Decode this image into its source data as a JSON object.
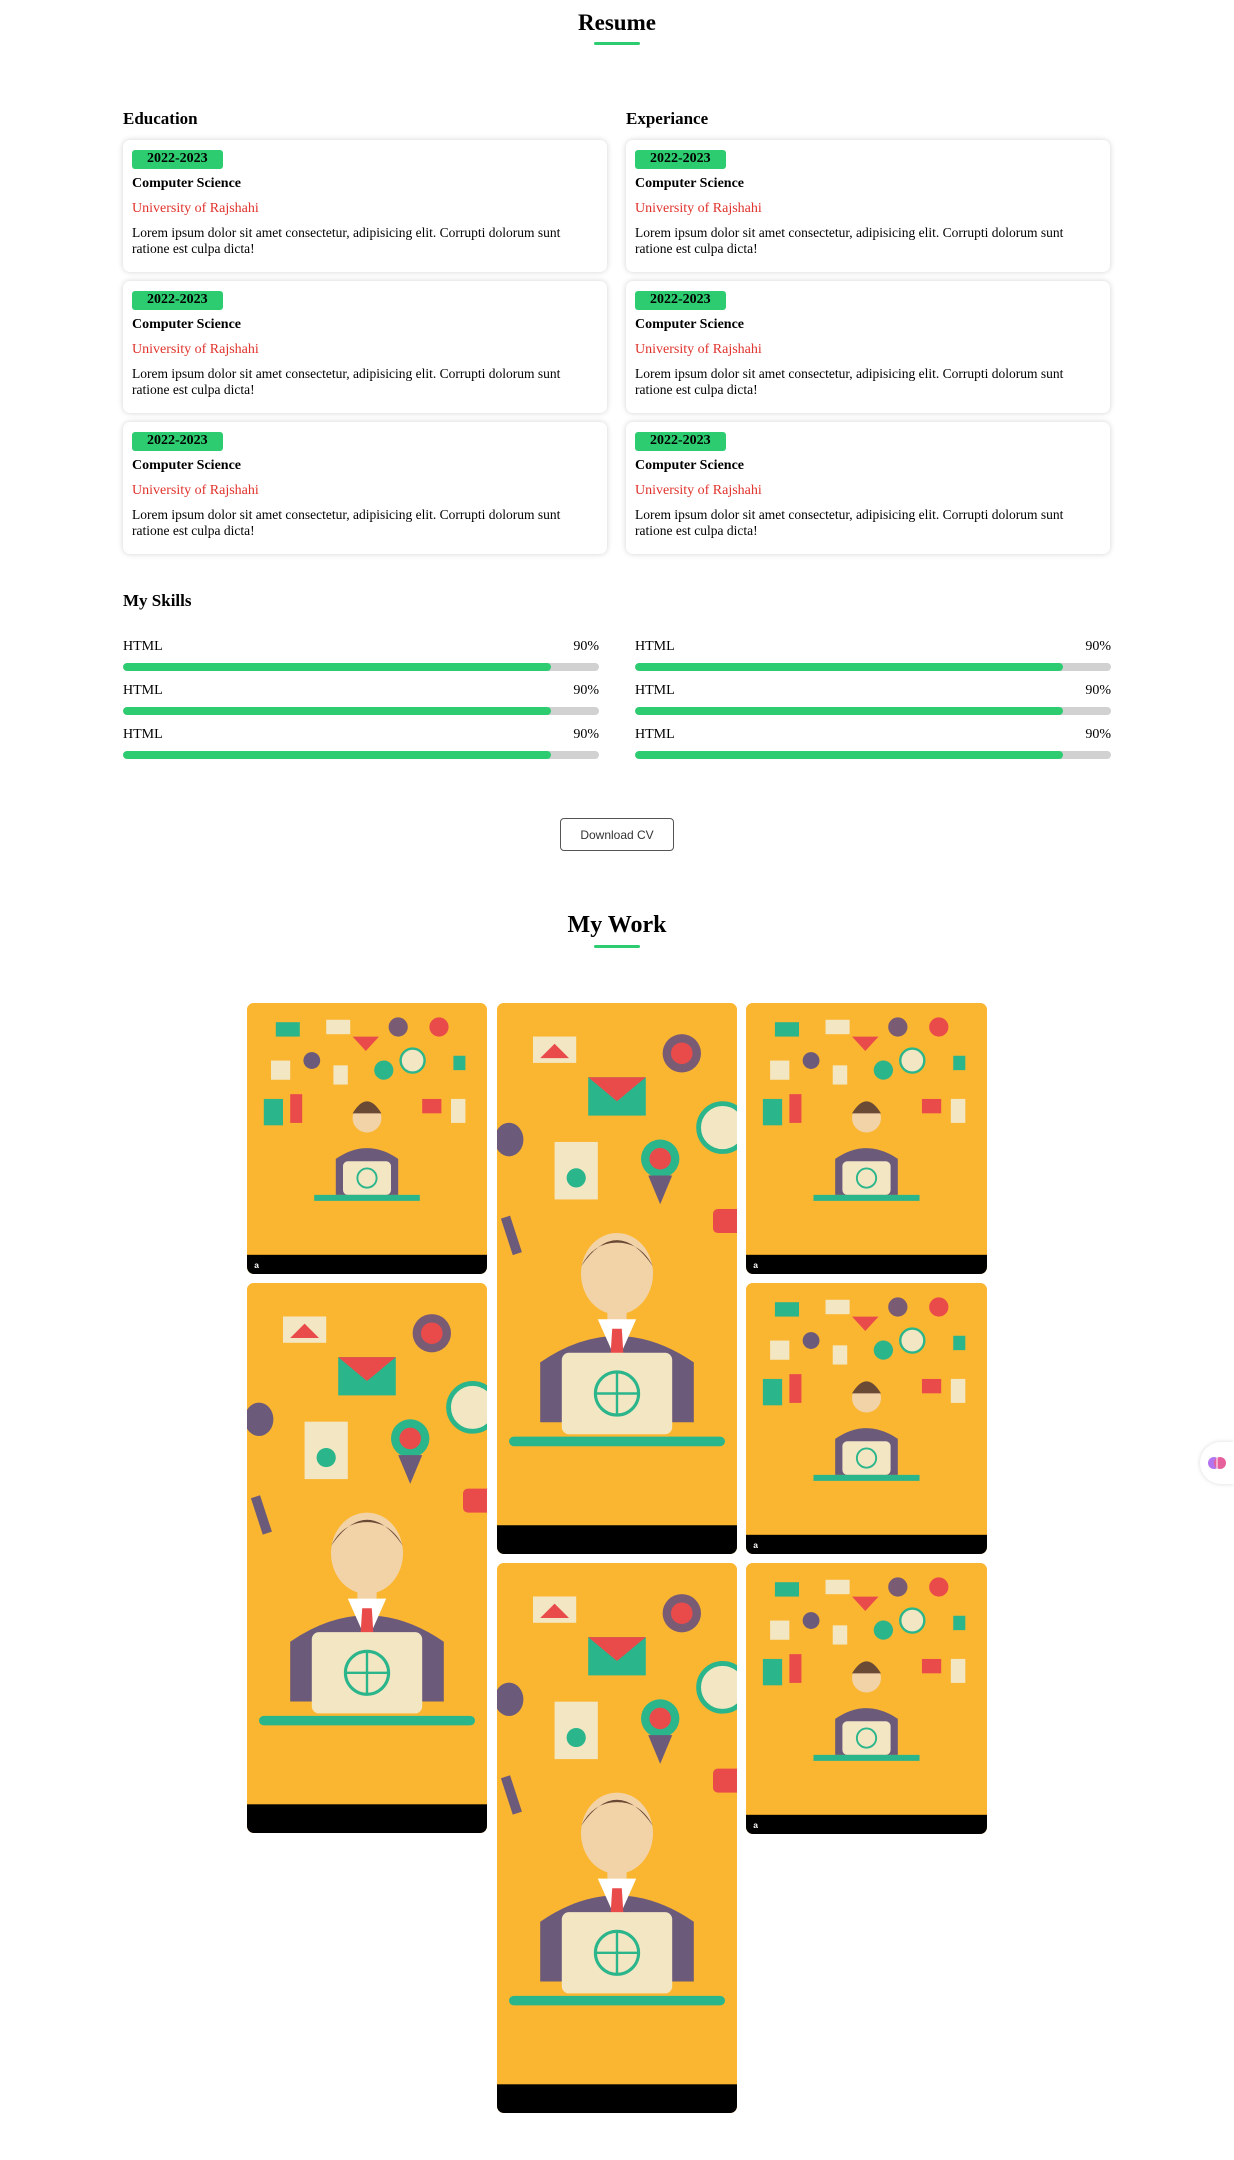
{
  "resume": {
    "title": "Resume"
  },
  "education": {
    "title": "Education",
    "items": [
      {
        "year": "2022-2023",
        "course": "Computer Science",
        "university": "University of Rajshahi",
        "description": "Lorem ipsum dolor sit amet consectetur, adipisicing elit. Corrupti dolorum sunt ratione est culpa dicta!"
      },
      {
        "year": "2022-2023",
        "course": "Computer Science",
        "university": "University of Rajshahi",
        "description": "Lorem ipsum dolor sit amet consectetur, adipisicing elit. Corrupti dolorum sunt ratione est culpa dicta!"
      },
      {
        "year": "2022-2023",
        "course": "Computer Science",
        "university": "University of Rajshahi",
        "description": "Lorem ipsum dolor sit amet consectetur, adipisicing elit. Corrupti dolorum sunt ratione est culpa dicta!"
      }
    ]
  },
  "experience": {
    "title": "Experiance",
    "items": [
      {
        "year": "2022-2023",
        "course": "Computer Science",
        "university": "University of Rajshahi",
        "description": "Lorem ipsum dolor sit amet consectetur, adipisicing elit. Corrupti dolorum sunt ratione est culpa dicta!"
      },
      {
        "year": "2022-2023",
        "course": "Computer Science",
        "university": "University of Rajshahi",
        "description": "Lorem ipsum dolor sit amet consectetur, adipisicing elit. Corrupti dolorum sunt ratione est culpa dicta!"
      },
      {
        "year": "2022-2023",
        "course": "Computer Science",
        "university": "University of Rajshahi",
        "description": "Lorem ipsum dolor sit amet consectetur, adipisicing elit. Corrupti dolorum sunt ratione est culpa dicta!"
      }
    ]
  },
  "skills": {
    "title": "My Skills",
    "items": [
      {
        "name": "HTML",
        "percent_label": "90%",
        "level": 0.9
      },
      {
        "name": "HTML",
        "percent_label": "90%",
        "level": 0.9
      },
      {
        "name": "HTML",
        "percent_label": "90%",
        "level": 0.9
      },
      {
        "name": "HTML",
        "percent_label": "90%",
        "level": 0.9
      },
      {
        "name": "HTML",
        "percent_label": "90%",
        "level": 0.9
      },
      {
        "name": "HTML",
        "percent_label": "90%",
        "level": 0.9
      }
    ]
  },
  "download": {
    "label": "Download CV"
  },
  "work": {
    "title": "My Work",
    "watermark": "alamy",
    "images": [
      "businessman-illustration",
      "businessman-illustration",
      "businessman-illustration",
      "businessman-illustration",
      "businessman-illustration",
      "businessman-illustration",
      "businessman-illustration"
    ]
  },
  "colors": {
    "accent": "#2ecc71",
    "university": "#e0322b",
    "image_bg": "#fbb631"
  },
  "icons": {
    "floating_widget": "brain-icon"
  }
}
